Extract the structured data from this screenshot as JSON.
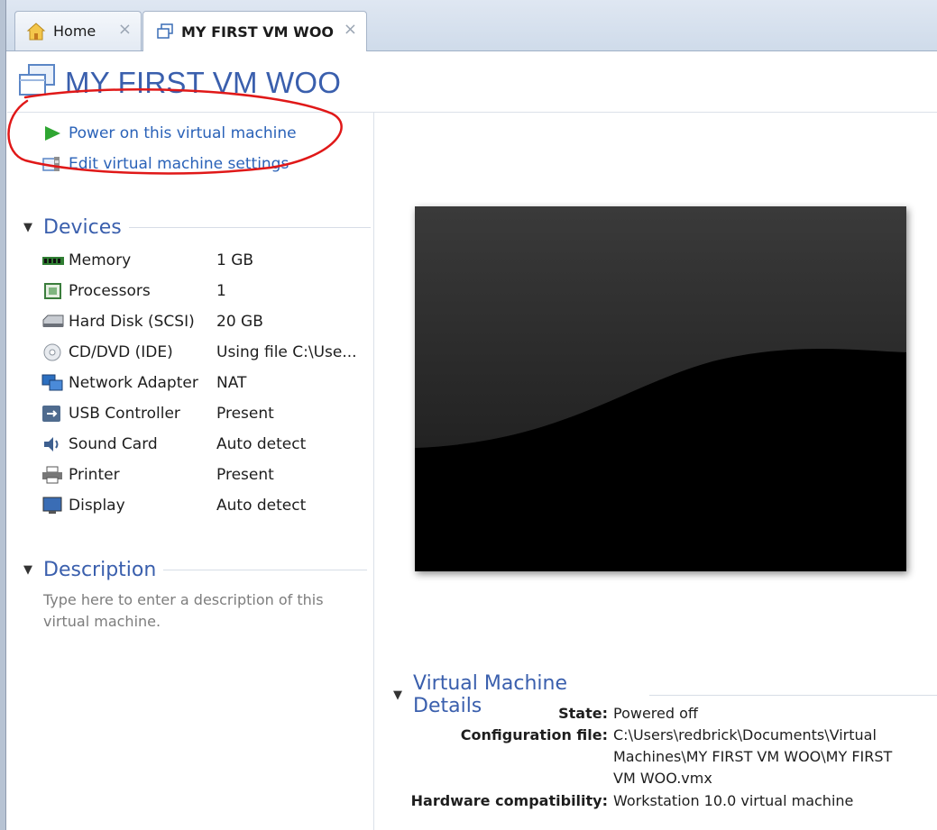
{
  "tabs": [
    {
      "label": "Home",
      "icon": "home-icon",
      "close": "×"
    },
    {
      "label": "MY FIRST VM WOO",
      "icon": "vm-icon",
      "close": "×"
    }
  ],
  "header": {
    "title": "MY FIRST VM WOO",
    "icon": "vm-icon",
    "title_color": "#3a5fad"
  },
  "actions": {
    "power_on": {
      "label": "Power on this virtual machine",
      "icon": "play-icon"
    },
    "edit_settings": {
      "label": "Edit virtual machine settings",
      "icon": "settings-icon"
    }
  },
  "devices": {
    "heading": "Devices",
    "items": [
      {
        "name": "Memory",
        "value": "1 GB",
        "icon": "memory-icon"
      },
      {
        "name": "Processors",
        "value": "1",
        "icon": "processor-icon"
      },
      {
        "name": "Hard Disk (SCSI)",
        "value": "20 GB",
        "icon": "hard-disk-icon"
      },
      {
        "name": "CD/DVD (IDE)",
        "value": "Using file C:\\Use...",
        "icon": "cd-dvd-icon"
      },
      {
        "name": "Network Adapter",
        "value": "NAT",
        "icon": "network-adapter-icon"
      },
      {
        "name": "USB Controller",
        "value": "Present",
        "icon": "usb-icon"
      },
      {
        "name": "Sound Card",
        "value": "Auto detect",
        "icon": "sound-icon"
      },
      {
        "name": "Printer",
        "value": "Present",
        "icon": "printer-icon"
      },
      {
        "name": "Display",
        "value": "Auto detect",
        "icon": "display-icon"
      }
    ]
  },
  "description": {
    "heading": "Description",
    "placeholder": "Type here to enter a description of this virtual machine."
  },
  "details": {
    "heading": "Virtual Machine Details",
    "state_label": "State:",
    "state_value": "Powered off",
    "config_label": "Configuration file:",
    "config_value_line1": "C:\\Users\\redbrick\\Documents\\Virtual",
    "config_value_line2": "Machines\\MY FIRST VM WOO\\MY FIRST",
    "config_value_line3": "VM WOO.vmx",
    "hw_label": "Hardware compatibility:",
    "hw_value": "Workstation 10.0 virtual machine"
  },
  "colors": {
    "link": "#2a62b8",
    "heading": "#3a5fad",
    "annotation": "#e01818"
  }
}
